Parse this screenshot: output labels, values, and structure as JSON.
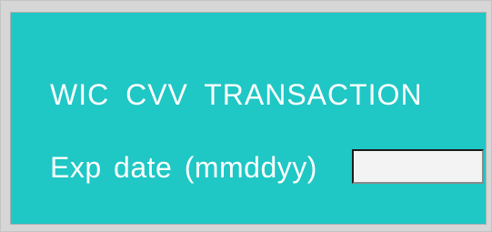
{
  "screen": {
    "title": "WIC  CVV  TRANSACTION",
    "exp_date_label": "Exp  date  (mmddyy)",
    "exp_date_value": "",
    "background_color": "#1fc7c5",
    "text_color": "#ffffff"
  }
}
